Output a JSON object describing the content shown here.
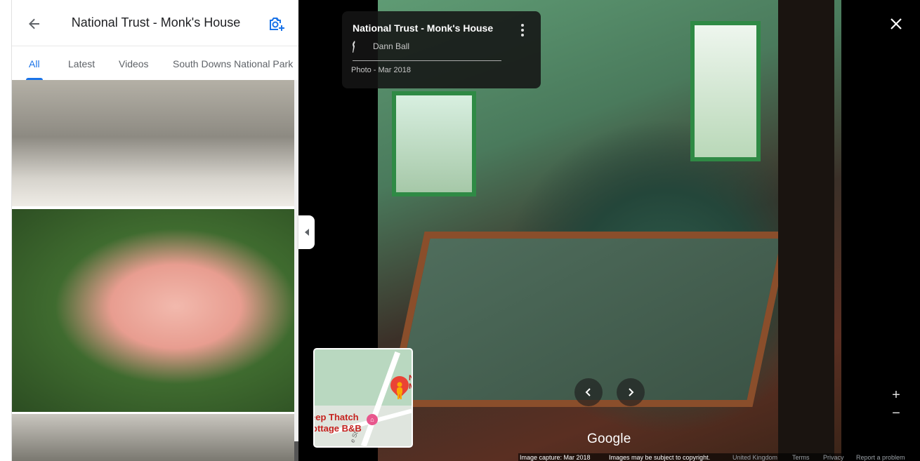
{
  "panel": {
    "title": "National Trust - Monk's House",
    "tabs": [
      {
        "label": "All",
        "active": true
      },
      {
        "label": "Latest"
      },
      {
        "label": "Videos"
      },
      {
        "label": "South Downs National Park"
      }
    ]
  },
  "photo_info": {
    "title": "National Trust - Monk's House",
    "author": "Dann Ball",
    "date": "Photo - Mar 2018"
  },
  "minimap": {
    "label_line1": "eep Thatch",
    "label_line2": "ottage B&B",
    "label_pin": "N M",
    "street": "e St"
  },
  "viewer": {
    "logo": "Google",
    "zoom_in": "+",
    "zoom_out": "−"
  },
  "footer": {
    "capture": "Image capture: Mar 2018",
    "copyright": "Images may be subject to copyright.",
    "region": "United Kingdom",
    "terms": "Terms",
    "privacy": "Privacy",
    "report": "Report a problem"
  },
  "colors": {
    "accent": "#1a73e8",
    "pin": "#ea4335"
  },
  "icons": {
    "back": "arrow-left-icon",
    "add_photo": "camera-plus-icon",
    "close": "close-icon",
    "prev": "chevron-left-icon",
    "next": "chevron-right-icon",
    "collapse": "triangle-left-icon"
  }
}
